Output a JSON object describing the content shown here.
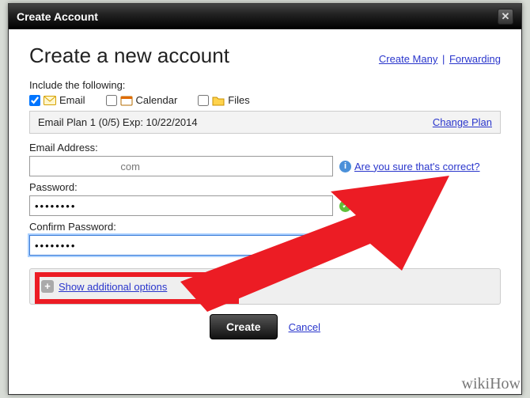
{
  "titlebar": {
    "title": "Create Account"
  },
  "heading": "Create a new account",
  "top_links": {
    "create_many": "Create Many",
    "forwarding": "Forwarding"
  },
  "include_label": "Include the following:",
  "options": {
    "email": {
      "label": "Email",
      "checked": true
    },
    "calendar": {
      "label": "Calendar",
      "checked": false
    },
    "files": {
      "label": "Files",
      "checked": false
    }
  },
  "plan": {
    "text": "Email Plan 1 (0/5) Exp: 10/22/2014",
    "change": "Change Plan"
  },
  "email": {
    "label": "Email Address:",
    "value": "                              com",
    "hint": "Are you sure that's correct?"
  },
  "password": {
    "label": "Password:",
    "value": "••••••••"
  },
  "confirm": {
    "label": "Confirm Password:",
    "value": "••••••••"
  },
  "advanced": {
    "link": "Show additional options"
  },
  "buttons": {
    "create": "Create",
    "cancel": "Cancel"
  },
  "watermark": "wikiHow"
}
